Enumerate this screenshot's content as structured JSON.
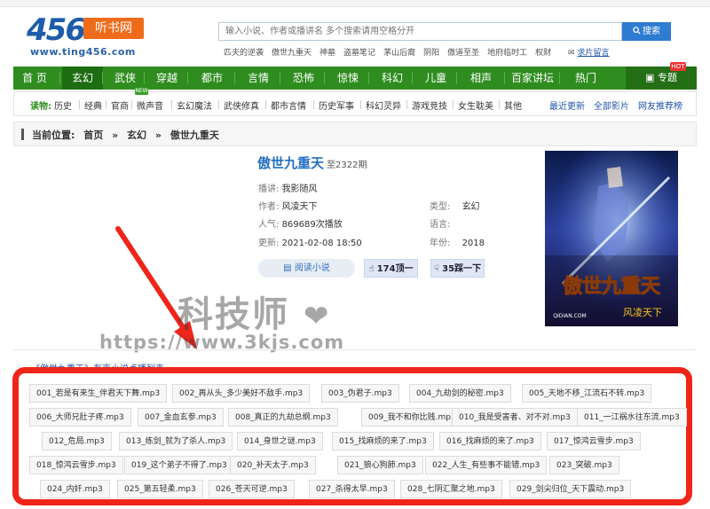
{
  "header": {
    "logo_number": "456",
    "logo_name": "听书网",
    "logo_url": "www.ting456.com",
    "search_placeholder": "输入小说、作者或播讲名 多个搜索请用空格分开",
    "search_button": "搜索",
    "hot_words": [
      "匹夫的逆袭",
      "傲世九重天",
      "神墓",
      "盗墓笔记",
      "茅山后裔",
      "阴阳",
      "傲道至圣",
      "地府临时工",
      "权财"
    ],
    "notice_label": "求片留言"
  },
  "nav": {
    "items": [
      "首 页",
      "玄幻",
      "武侠",
      "穿越",
      "都市",
      "言情",
      "恐怖",
      "惊悚",
      "科幻",
      "儿童",
      "相声",
      "百家讲坛",
      "热门"
    ],
    "active": "玄幻",
    "vip_label": "专题",
    "hot_badge": "HOT"
  },
  "categories": {
    "label": "读物:",
    "items": [
      "历史",
      "经典",
      "官商",
      "微声音",
      "玄幻魔法",
      "武侠修真",
      "都市言情",
      "历史军事",
      "科幻灵异",
      "游戏竞技",
      "女生耽美",
      "其他"
    ],
    "new_badge": "NEW",
    "right_links": [
      "最近更新",
      "全部影片",
      "网友推荐榜"
    ]
  },
  "breadcrumb": {
    "label": "当前位置:",
    "items": [
      "首页",
      "»",
      "玄幻",
      "»",
      "傲世九重天"
    ]
  },
  "book": {
    "title": "傲世九重天",
    "episode_count": "至2322期",
    "narrator_label": "播讲:",
    "narrator": "我影随风",
    "author_label": "作者:",
    "author": "风凌天下",
    "type_label": "类型:",
    "type": "玄幻",
    "popularity_label": "人气:",
    "popularity": "869689次播放",
    "language_label": "语言:",
    "language": "",
    "updated_label": "更新:",
    "updated": "2021-02-08 18:50",
    "year_label": "年份:",
    "year": "2018",
    "read_button": "阅读小说",
    "upvote": "174顶一",
    "downvote": "35踩一下",
    "cover_title": "傲世九重天",
    "cover_author": "风凌天下",
    "cover_site": "QIDIAN.COM"
  },
  "watermark": {
    "line1": "科技师",
    "line2": "https://www.3kjs.com"
  },
  "episode_list": {
    "heading": "《傲世九重天》有声小说点播列表:",
    "episodes": [
      "001_若是有来生_伴君天下舞.mp3",
      "002_再从头_多少美好不敌手.mp3",
      "003_伪君子.mp3",
      "004_九劫剑的秘密.mp3",
      "005_天地不移_江流石不转.mp3",
      "006_大师兄肚子疼.mp3",
      "007_金血玄参.mp3",
      "008_真正的九劫总纲.mp3",
      "009_我不和你比贱.mp3",
      "010_我是受害者、对不对.mp3",
      "011_一江祸水往东流.mp3",
      "012_危局.mp3",
      "013_练剑_就为了杀人.mp3",
      "014_身世之谜.mp3",
      "015_找麻烦的来了.mp3",
      "016_找麻烦的来了.mp3",
      "017_惊鸿云雪步.mp3",
      "018_惊鸿云雪步.mp3",
      "019_这个弟子不得了.mp3",
      "020_补天太子.mp3",
      "021_狼心狗肺.mp3",
      "022_人生_有些事不能错.mp3",
      "023_突破.mp3",
      "024_内奸.mp3",
      "025_第五轻柔.mp3",
      "026_苍天可逆.mp3",
      "027_杀得太早.mp3",
      "028_七阴汇聚之地.mp3",
      "029_剑尖归位_天下震动.mp3"
    ]
  },
  "colors": {
    "nav_green": "#2f8d20",
    "title_blue": "#2470c2",
    "highlight_red": "#f0251a",
    "logo_orange": "#ee6b1b"
  }
}
